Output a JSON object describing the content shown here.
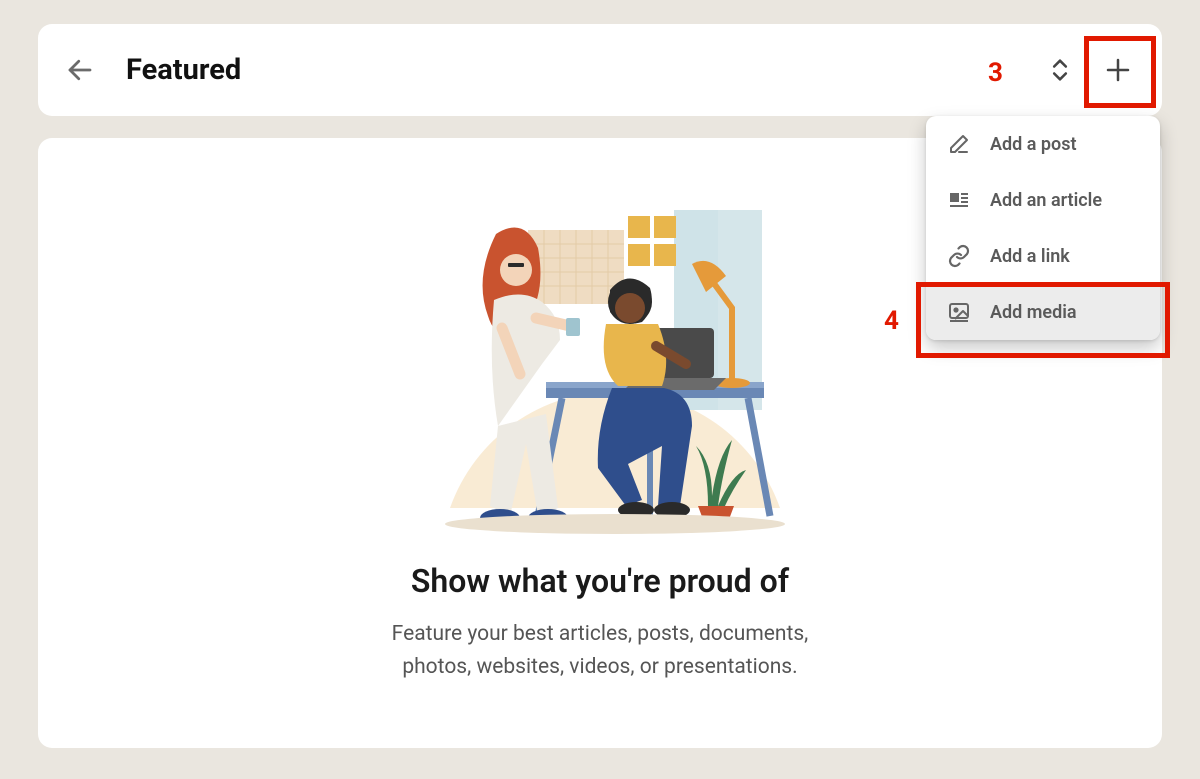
{
  "header": {
    "title": "Featured"
  },
  "body": {
    "headline": "Show what you're proud of",
    "subtext": "Feature your best articles, posts, documents, photos, websites, videos, or presentations."
  },
  "dropdown": {
    "items": [
      {
        "label": "Add a post",
        "icon": "compose-icon"
      },
      {
        "label": "Add an article",
        "icon": "article-icon"
      },
      {
        "label": "Add a link",
        "icon": "link-icon"
      },
      {
        "label": "Add media",
        "icon": "media-icon"
      }
    ]
  },
  "annotations": {
    "a3": "3",
    "a4": "4"
  }
}
